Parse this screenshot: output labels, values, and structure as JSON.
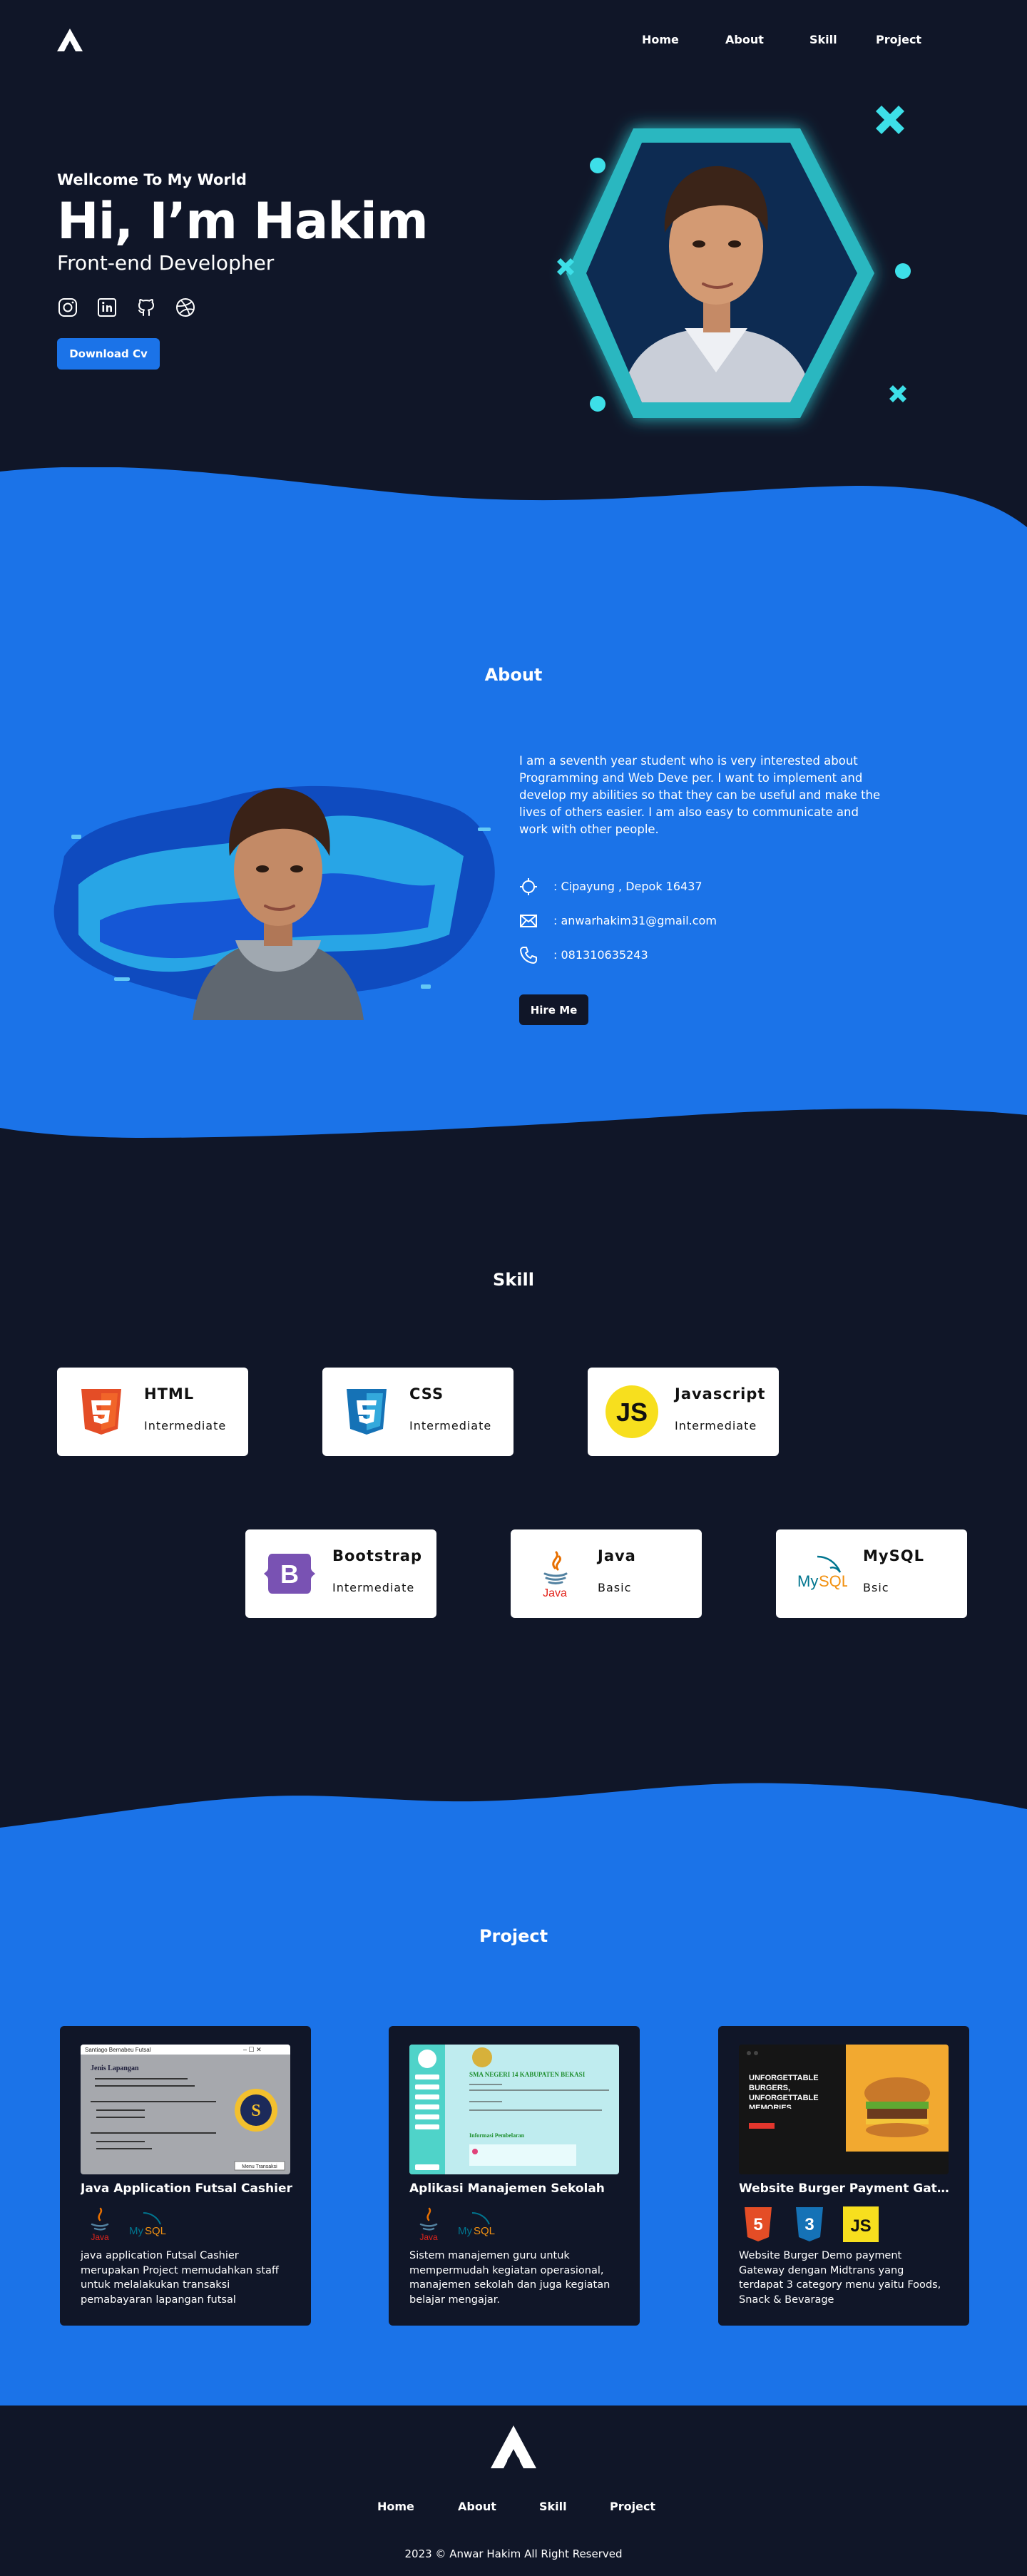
{
  "colors": {
    "background": "#101628",
    "accent": "#1b73e8",
    "glow": "#3ddfe8",
    "card": "#ffffff"
  },
  "nav": {
    "logo_icon": "logo-mark-icon",
    "items": [
      {
        "label": "Home"
      },
      {
        "label": "About"
      },
      {
        "label": "Skill"
      },
      {
        "label": "Project"
      }
    ]
  },
  "hero": {
    "welcome": "Wellcome To My World",
    "name": "Hi, I’m Hakim",
    "role": "Front-end Developher",
    "socials": [
      {
        "icon": "instagram-icon"
      },
      {
        "icon": "linkedin-icon"
      },
      {
        "icon": "github-icon"
      },
      {
        "icon": "dribbble-icon"
      }
    ],
    "cta": "Download Cv"
  },
  "about": {
    "title": "About",
    "description": "I am a seventh year student who is very interested about Programming and Web Deve per. I want to implement and develop my abilities so that they can be useful and make the lives of others easier. I am also easy to communicate and work with other people.",
    "address": ": Cipayung , Depok 16437",
    "email": ": anwarhakim31@gmail.com",
    "phone": ": 081310635243",
    "cta": "Hire Me"
  },
  "skills": {
    "title": "Skill",
    "items": [
      {
        "name": "HTML",
        "level": "Intermediate",
        "icon": "html5-icon"
      },
      {
        "name": "CSS",
        "level": "Intermediate",
        "icon": "css3-icon"
      },
      {
        "name": "Javascript",
        "level": "Intermediate",
        "icon": "javascript-icon"
      },
      {
        "name": "Bootstrap",
        "level": "Intermediate",
        "icon": "bootstrap-icon"
      },
      {
        "name": "Java",
        "level": "Basic",
        "icon": "java-icon"
      },
      {
        "name": "MySQL",
        "level": "Bsic",
        "icon": "mysql-icon"
      }
    ]
  },
  "projects": {
    "title": "Project",
    "items": [
      {
        "title": "Java Application Futsal Cashier",
        "description": "java application Futsal Cashier merupakan Project memudahkan staff untuk melalakukan transaksi pemabayaran lapangan futsal",
        "thumb_window_title": "Santiago Bernabeu Futsal",
        "thumb_heading": "Jenis Lapangan",
        "thumb_button": "Menu Transaksi",
        "tech": [
          "java-icon",
          "mysql-icon"
        ]
      },
      {
        "title": "Aplikasi Manajemen Sekolah",
        "description": "Sistem manajemen  guru untuk mempermudah kegiatan operasional, manajemen sekolah dan juga kegiatan belajar mengajar.",
        "thumb_heading": "SMA NEGERI 14 KABUPATEN BEKASI",
        "thumb_footer": "Informasi Pembelaran",
        "tech": [
          "java-icon",
          "mysql-icon"
        ]
      },
      {
        "title": "Website Burger Payment Gateway Midtrans",
        "description": "Website Burger Demo payment Gateway dengan Midtrans  yang terdapat 3 category menu yaitu Foods, Snack & Bevarage",
        "thumb_heading": "UNFORGETTABLE BURGERS, UNFORGETTABLE MEMORIES",
        "tech": [
          "html5-icon",
          "css3-icon",
          "javascript-icon"
        ]
      }
    ]
  },
  "footer": {
    "logo_icon": "logo-mark-icon",
    "items": [
      {
        "label": "Home"
      },
      {
        "label": "About"
      },
      {
        "label": "Skill"
      },
      {
        "label": "Project"
      }
    ],
    "copyright": "2023 © Anwar Hakim All Right Reserved"
  }
}
